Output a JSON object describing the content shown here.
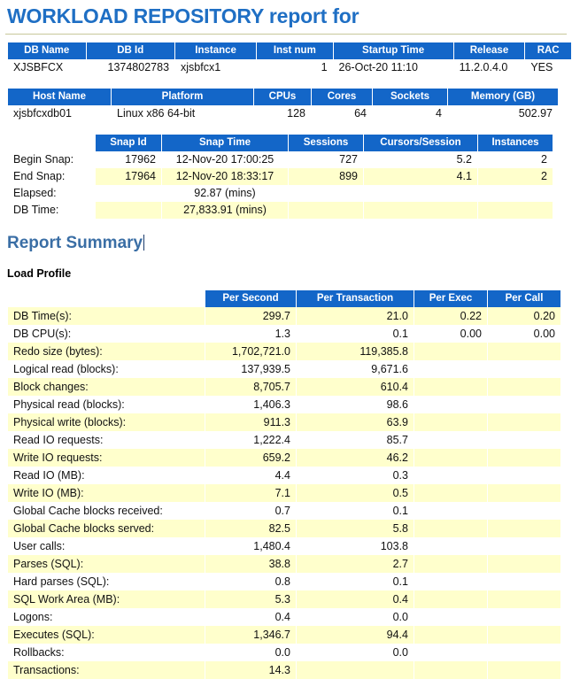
{
  "report": {
    "title": "WORKLOAD REPOSITORY report for"
  },
  "db_info": {
    "headers": [
      "DB Name",
      "DB Id",
      "Instance",
      "Inst num",
      "Startup Time",
      "Release",
      "RAC"
    ],
    "row": {
      "db_name": "XJSBFCX",
      "db_id": "1374802783",
      "instance": "xjsbfcx1",
      "inst_num": "1",
      "startup_time": "26-Oct-20 11:10",
      "release": "11.2.0.4.0",
      "rac": "YES"
    }
  },
  "host_info": {
    "headers": [
      "Host Name",
      "Platform",
      "CPUs",
      "Cores",
      "Sockets",
      "Memory (GB)"
    ],
    "row": {
      "host_name": "xjsbfcxdb01",
      "platform": "Linux x86 64-bit",
      "cpus": "128",
      "cores": "64",
      "sockets": "4",
      "memory_gb": "502.97"
    }
  },
  "snapshot_info": {
    "headers": [
      "",
      "Snap Id",
      "Snap Time",
      "Sessions",
      "Cursors/Session",
      "Instances"
    ],
    "rows": [
      {
        "label": "Begin Snap:",
        "snap_id": "17962",
        "snap_time": "12-Nov-20 17:00:25",
        "sessions": "727",
        "cursors_session": "5.2",
        "instances": "2"
      },
      {
        "label": "End Snap:",
        "snap_id": "17964",
        "snap_time": "12-Nov-20 18:33:17",
        "sessions": "899",
        "cursors_session": "4.1",
        "instances": "2"
      },
      {
        "label": "Elapsed:",
        "snap_id": "",
        "snap_time": "92.87 (mins)",
        "sessions": "",
        "cursors_session": "",
        "instances": ""
      },
      {
        "label": "DB Time:",
        "snap_id": "",
        "snap_time": "27,833.91 (mins)",
        "sessions": "",
        "cursors_session": "",
        "instances": ""
      }
    ]
  },
  "summary": {
    "heading": "Report Summary",
    "load_profile_heading": "Load Profile"
  },
  "load_profile": {
    "headers": [
      "",
      "Per Second",
      "Per Transaction",
      "Per Exec",
      "Per Call"
    ],
    "rows": [
      {
        "metric": "DB Time(s):",
        "per_second": "299.7",
        "per_transaction": "21.0",
        "per_exec": "0.22",
        "per_call": "0.20"
      },
      {
        "metric": "DB CPU(s):",
        "per_second": "1.3",
        "per_transaction": "0.1",
        "per_exec": "0.00",
        "per_call": "0.00"
      },
      {
        "metric": "Redo size (bytes):",
        "per_second": "1,702,721.0",
        "per_transaction": "119,385.8",
        "per_exec": "",
        "per_call": ""
      },
      {
        "metric": "Logical read (blocks):",
        "per_second": "137,939.5",
        "per_transaction": "9,671.6",
        "per_exec": "",
        "per_call": ""
      },
      {
        "metric": "Block changes:",
        "per_second": "8,705.7",
        "per_transaction": "610.4",
        "per_exec": "",
        "per_call": ""
      },
      {
        "metric": "Physical read (blocks):",
        "per_second": "1,406.3",
        "per_transaction": "98.6",
        "per_exec": "",
        "per_call": ""
      },
      {
        "metric": "Physical write (blocks):",
        "per_second": "911.3",
        "per_transaction": "63.9",
        "per_exec": "",
        "per_call": ""
      },
      {
        "metric": "Read IO requests:",
        "per_second": "1,222.4",
        "per_transaction": "85.7",
        "per_exec": "",
        "per_call": ""
      },
      {
        "metric": "Write IO requests:",
        "per_second": "659.2",
        "per_transaction": "46.2",
        "per_exec": "",
        "per_call": ""
      },
      {
        "metric": "Read IO (MB):",
        "per_second": "4.4",
        "per_transaction": "0.3",
        "per_exec": "",
        "per_call": ""
      },
      {
        "metric": "Write IO (MB):",
        "per_second": "7.1",
        "per_transaction": "0.5",
        "per_exec": "",
        "per_call": ""
      },
      {
        "metric": "Global Cache blocks received:",
        "per_second": "0.7",
        "per_transaction": "0.1",
        "per_exec": "",
        "per_call": ""
      },
      {
        "metric": "Global Cache blocks served:",
        "per_second": "82.5",
        "per_transaction": "5.8",
        "per_exec": "",
        "per_call": ""
      },
      {
        "metric": "User calls:",
        "per_second": "1,480.4",
        "per_transaction": "103.8",
        "per_exec": "",
        "per_call": ""
      },
      {
        "metric": "Parses (SQL):",
        "per_second": "38.8",
        "per_transaction": "2.7",
        "per_exec": "",
        "per_call": ""
      },
      {
        "metric": "Hard parses (SQL):",
        "per_second": "0.8",
        "per_transaction": "0.1",
        "per_exec": "",
        "per_call": ""
      },
      {
        "metric": "SQL Work Area (MB):",
        "per_second": "5.3",
        "per_transaction": "0.4",
        "per_exec": "",
        "per_call": ""
      },
      {
        "metric": "Logons:",
        "per_second": "0.4",
        "per_transaction": "0.0",
        "per_exec": "",
        "per_call": ""
      },
      {
        "metric": "Executes (SQL):",
        "per_second": "1,346.7",
        "per_transaction": "94.4",
        "per_exec": "",
        "per_call": ""
      },
      {
        "metric": "Rollbacks:",
        "per_second": "0.0",
        "per_transaction": "0.0",
        "per_exec": "",
        "per_call": ""
      },
      {
        "metric": "Transactions:",
        "per_second": "14.3",
        "per_transaction": "",
        "per_exec": "",
        "per_call": ""
      }
    ]
  },
  "colors": {
    "header_blue": "#1366c8",
    "title_blue": "#1f6fc4",
    "section_blue": "#3a6ea5",
    "shade_row": "#ffffcc",
    "rule": "#c8c89a"
  }
}
